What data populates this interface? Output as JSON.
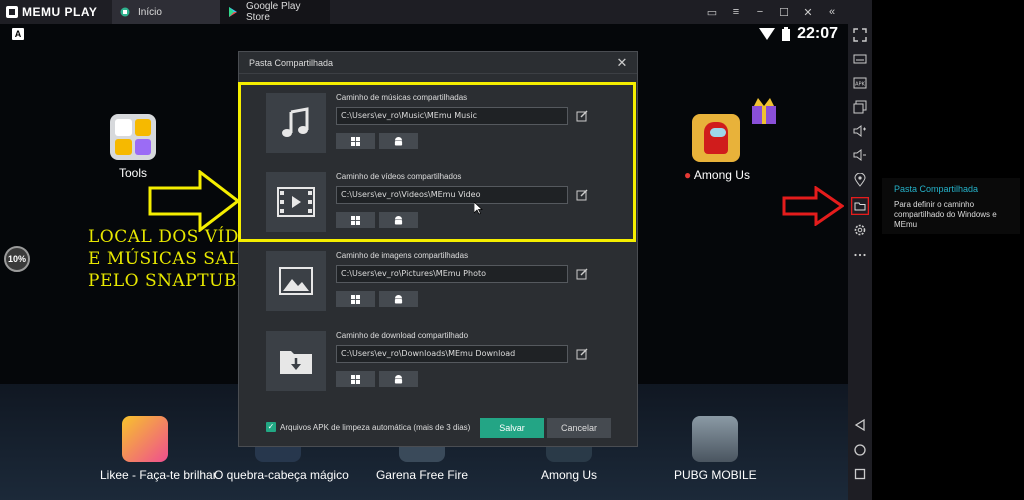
{
  "titlebar": {
    "logo": "MEMU PLAY",
    "tabs": [
      {
        "label": "Início",
        "active": true
      },
      {
        "label": "Google Play Store",
        "active": false
      }
    ]
  },
  "statusbar": {
    "time": "22:07",
    "badge": "A"
  },
  "apps_top": [
    {
      "label": "Tools"
    },
    {
      "label": "Among Us"
    }
  ],
  "apps_bottom": [
    {
      "label": "Likee - Faça-te brilhar"
    },
    {
      "label": "O quebra-cabeça mágico"
    },
    {
      "label": "Garena Free Fire"
    },
    {
      "label": "Among Us"
    },
    {
      "label": "PUBG MOBILE"
    }
  ],
  "annotation": {
    "lines": [
      "LOCAL DOS VÍDEOS",
      "E MÚSICAS SALVOS",
      "PELO SNAPTUBE"
    ],
    "highlight_color": "#f5ee00",
    "arrow_color": "#e51c1c"
  },
  "progress_badge": "10%",
  "dialog": {
    "title": "Pasta Compartilhada",
    "rows": [
      {
        "label": "Caminho de músicas compartilhadas",
        "path": "C:\\Users\\ev_ro\\Music\\MEmu Music",
        "icon": "music-icon"
      },
      {
        "label": "Caminho de vídeos compartilhados",
        "path": "C:\\Users\\ev_ro\\Videos\\MEmu Video",
        "icon": "video-icon"
      },
      {
        "label": "Caminho de imagens compartilhadas",
        "path": "C:\\Users\\ev_ro\\Pictures\\MEmu Photo",
        "icon": "image-icon"
      },
      {
        "label": "Caminho de download compartilhado",
        "path": "C:\\Users\\ev_ro\\Downloads\\MEmu Download",
        "icon": "download-folder-icon"
      }
    ],
    "checkbox_label": "Arquivos APK de limpeza automática (mais de 3 dias)",
    "checkbox_checked": true,
    "save_label": "Salvar",
    "cancel_label": "Cancelar"
  },
  "tooltip": {
    "title": "Pasta Compartilhada",
    "description": "Para definir o caminho compartilhado do Windows e MEmu"
  },
  "colors": {
    "accent": "#23a585",
    "tooltip_title": "#25b1c8"
  }
}
